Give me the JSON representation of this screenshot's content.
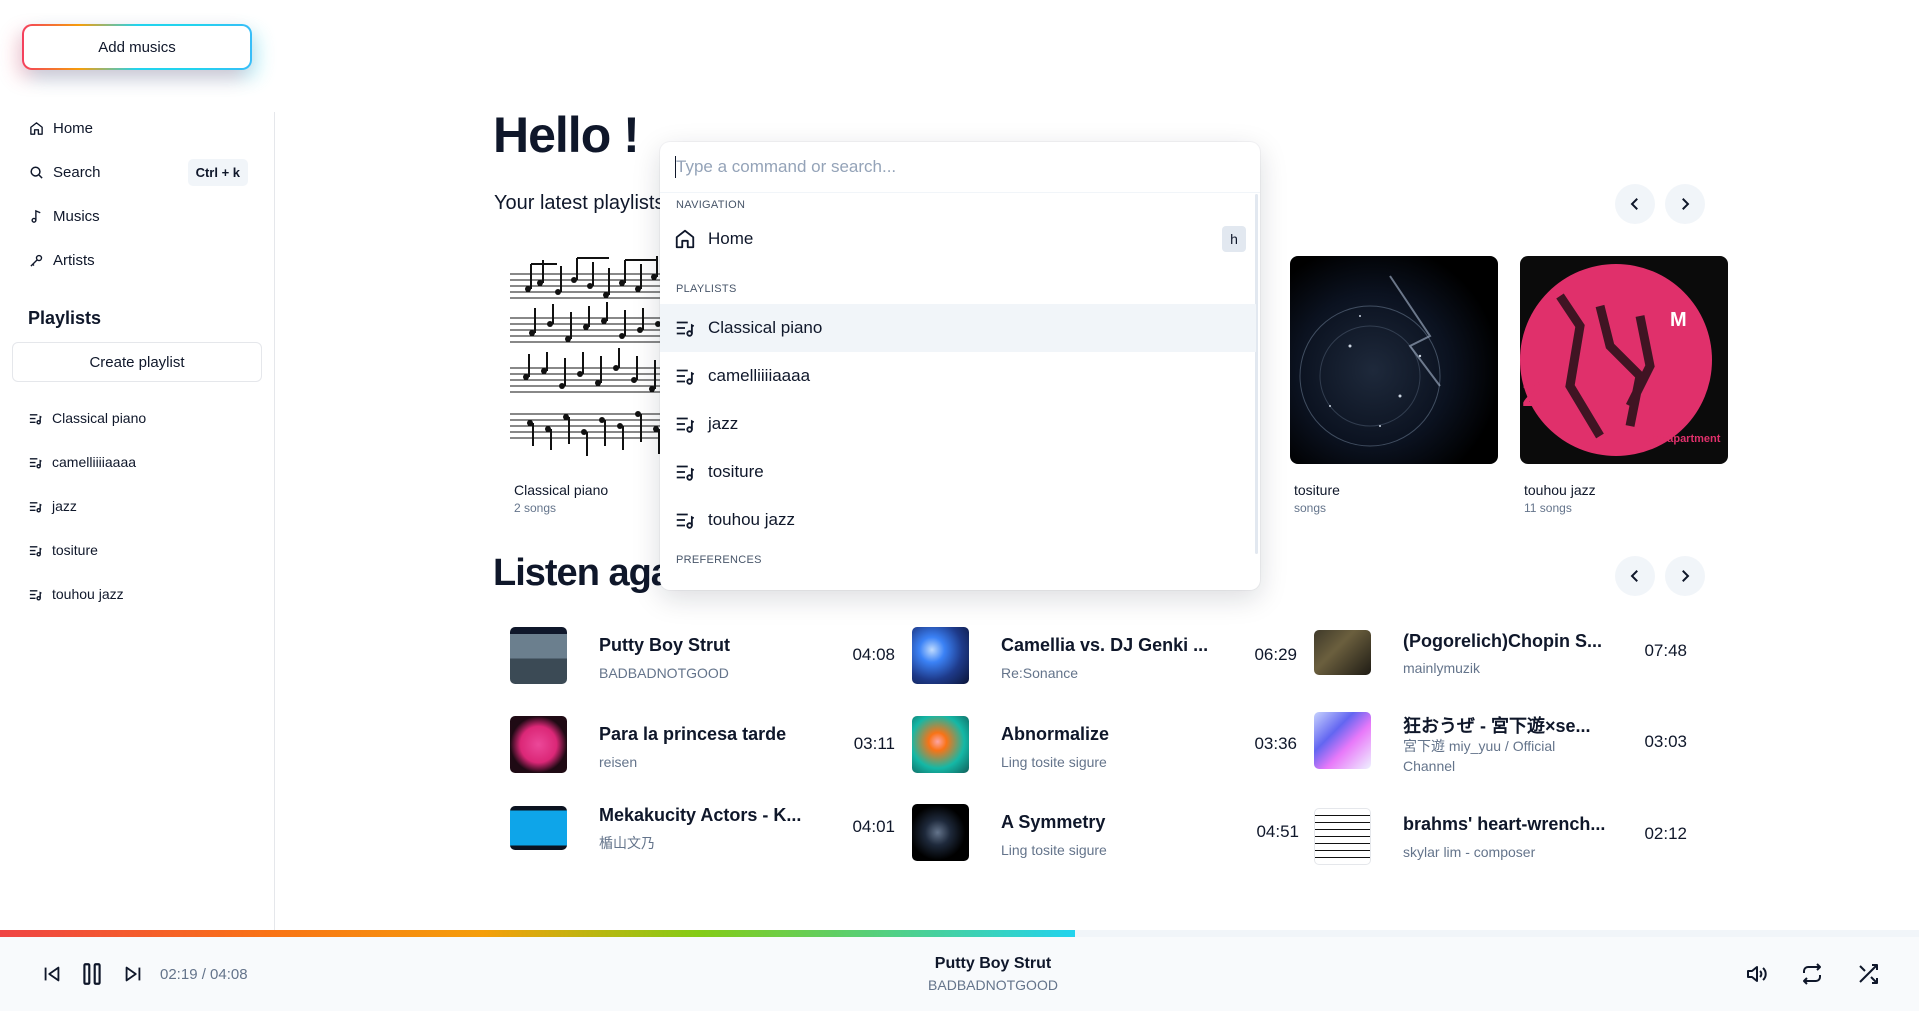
{
  "sidebar": {
    "add_musics": "Add musics",
    "nav": [
      {
        "label": "Home",
        "icon": "home-icon"
      },
      {
        "label": "Search",
        "icon": "search-icon",
        "shortcut": "Ctrl + k"
      },
      {
        "label": "Musics",
        "icon": "music-note-icon"
      },
      {
        "label": "Artists",
        "icon": "microphone-icon"
      }
    ],
    "playlists_title": "Playlists",
    "create_playlist": "Create playlist",
    "playlists": [
      "Classical piano",
      "camelliiiiaaaa",
      "jazz",
      "tositure",
      "touhou jazz"
    ]
  },
  "main": {
    "greeting": "Hello !",
    "latest_playlists": "Your latest playlists",
    "cards": [
      {
        "name": "Classical piano",
        "count": "2 songs"
      },
      {
        "name": "tositure",
        "count": "songs"
      },
      {
        "name": "touhou jazz",
        "count": "11 songs"
      }
    ],
    "listen_again": "Listen again",
    "songs": [
      {
        "title": "Putty Boy Strut",
        "artist": "BADBADNOTGOOD",
        "duration": "04:08"
      },
      {
        "title": "Camellia vs. DJ Genki ...",
        "artist": "Re:Sonance",
        "duration": "06:29"
      },
      {
        "title": "(Pogorelich)Chopin S...",
        "artist": "mainlymuzik",
        "duration": "07:48"
      },
      {
        "title": "Para la princesa tarde",
        "artist": "reisen",
        "duration": "03:11"
      },
      {
        "title": "Abnormalize",
        "artist": "Ling tosite sigure",
        "duration": "03:36"
      },
      {
        "title": "狂おうぜ - 宮下遊×se...",
        "artist": "宮下遊 miy_yuu / Official Channel",
        "duration": "03:03"
      },
      {
        "title": "Mekakucity Actors - K...",
        "artist": "楯山文乃",
        "duration": "04:01"
      },
      {
        "title": "A Symmetry",
        "artist": "Ling tosite sigure",
        "duration": "04:51"
      },
      {
        "title": "brahms' heart-wrench...",
        "artist": "skylar lim - composer",
        "duration": "02:12"
      }
    ]
  },
  "palette": {
    "placeholder": "Type a command or search...",
    "groups": {
      "navigation": "NAVIGATION",
      "playlists": "PLAYLISTS",
      "preferences": "PREFERENCES"
    },
    "home": {
      "label": "Home",
      "shortcut": "h"
    },
    "playlists": [
      "Classical piano",
      "camelliiiiaaaa",
      "jazz",
      "tositure",
      "touhou jazz"
    ],
    "active_index": 0
  },
  "player": {
    "time": "02:19 / 04:08",
    "progress": 0.56,
    "title": "Putty Boy Strut",
    "artist": "BADBADNOTGOOD"
  },
  "colors": {
    "accent_gradient": [
      "#ef4444",
      "#f59e0b",
      "#84cc16",
      "#22d3ee"
    ],
    "muted": "#64748b",
    "surface": "#f1f5f9"
  }
}
